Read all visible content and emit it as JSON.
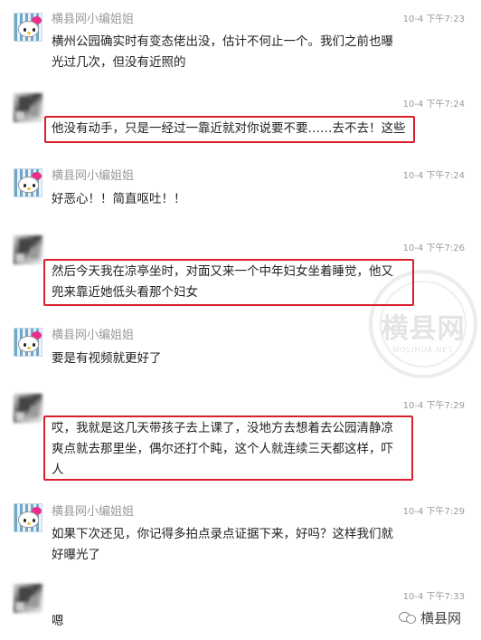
{
  "messages": [
    {
      "sender": "横县网小编姐姐",
      "time": "10-4 下午7:23",
      "avatar": "hello-kitty-avatar",
      "lines": [
        "横州公园确实时有变态佬出没，估计不何止一个。我们之前也曝",
        "光过几次，但没有近照的"
      ]
    },
    {
      "sender": "",
      "time": "10-4 下午7:24",
      "avatar": "blurred-avatar",
      "lines": [
        "他没有动手，只是一经过一靠近就对你说要不要……去不去！这些"
      ]
    },
    {
      "sender": "横县网小编姐姐",
      "time": "10-4 下午7:24",
      "avatar": "hello-kitty-avatar",
      "lines": [
        "好恶心！！简直呕吐！！"
      ]
    },
    {
      "sender": "",
      "time": "10-4 下午7:26",
      "avatar": "blurred-avatar",
      "lines": [
        "然后今天我在凉亭坐时，对面又来一个中年妇女坐着睡觉，他又",
        "兜来靠近她低头看那个妇女"
      ]
    },
    {
      "sender": "横县网小编姐姐",
      "time": "",
      "avatar": "hello-kitty-avatar",
      "lines": [
        "要是有视频就更好了"
      ]
    },
    {
      "sender": "",
      "time": "10-4 下午7:29",
      "avatar": "blurred-avatar",
      "lines": [
        "哎，我就是这几天带孩子去上课了，没地方去想着去公园清静凉",
        "爽点就去那里坐，偶尔还打个盹，这个人就连续三天都这样，吓",
        "人"
      ]
    },
    {
      "sender": "横县网小编姐姐",
      "time": "10-4 下午7:29",
      "avatar": "hello-kitty-avatar",
      "lines": [
        "如果下次还见，你记得多拍点录点证据下来，好吗？这样我们就",
        "好曝光了"
      ]
    },
    {
      "sender": "",
      "time": "10-4 下午7:33",
      "avatar": "blurred-avatar",
      "lines": [
        "嗯"
      ]
    }
  ],
  "watermark": {
    "text": "横县网",
    "sub": "MOLIHUA.NET"
  },
  "logo": {
    "text": "横县网",
    "icon": "wechat-icon"
  },
  "colors": {
    "highlight_border": "#d9212e",
    "meta_text": "#9a9a9a"
  }
}
